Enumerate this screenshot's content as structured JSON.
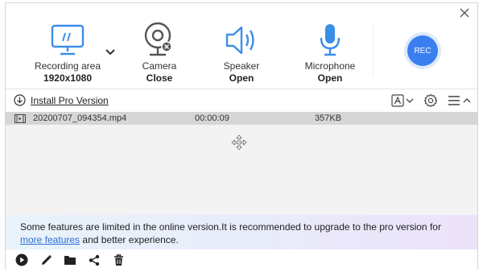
{
  "toolbar": {
    "recording_area": {
      "label": "Recording area",
      "value": "1920x1080"
    },
    "camera": {
      "label": "Camera",
      "value": "Close"
    },
    "speaker": {
      "label": "Speaker",
      "value": "Open"
    },
    "microphone": {
      "label": "Microphone",
      "value": "Open"
    },
    "rec_label": "REC"
  },
  "actionbar": {
    "install_label": "Install Pro Version"
  },
  "files": [
    {
      "name": "20200707_094354.mp4",
      "duration": "00:00:09",
      "size": "357KB"
    }
  ],
  "banner": {
    "text_before": "Some features are limited in the online version.It is recommended to upgrade to the pro version for",
    "link": "more features",
    "text_after": "and better experience."
  },
  "colors": {
    "accent": "#3a7ff0",
    "icon_blue": "#3b8ee8",
    "icon_gray": "#555555"
  }
}
